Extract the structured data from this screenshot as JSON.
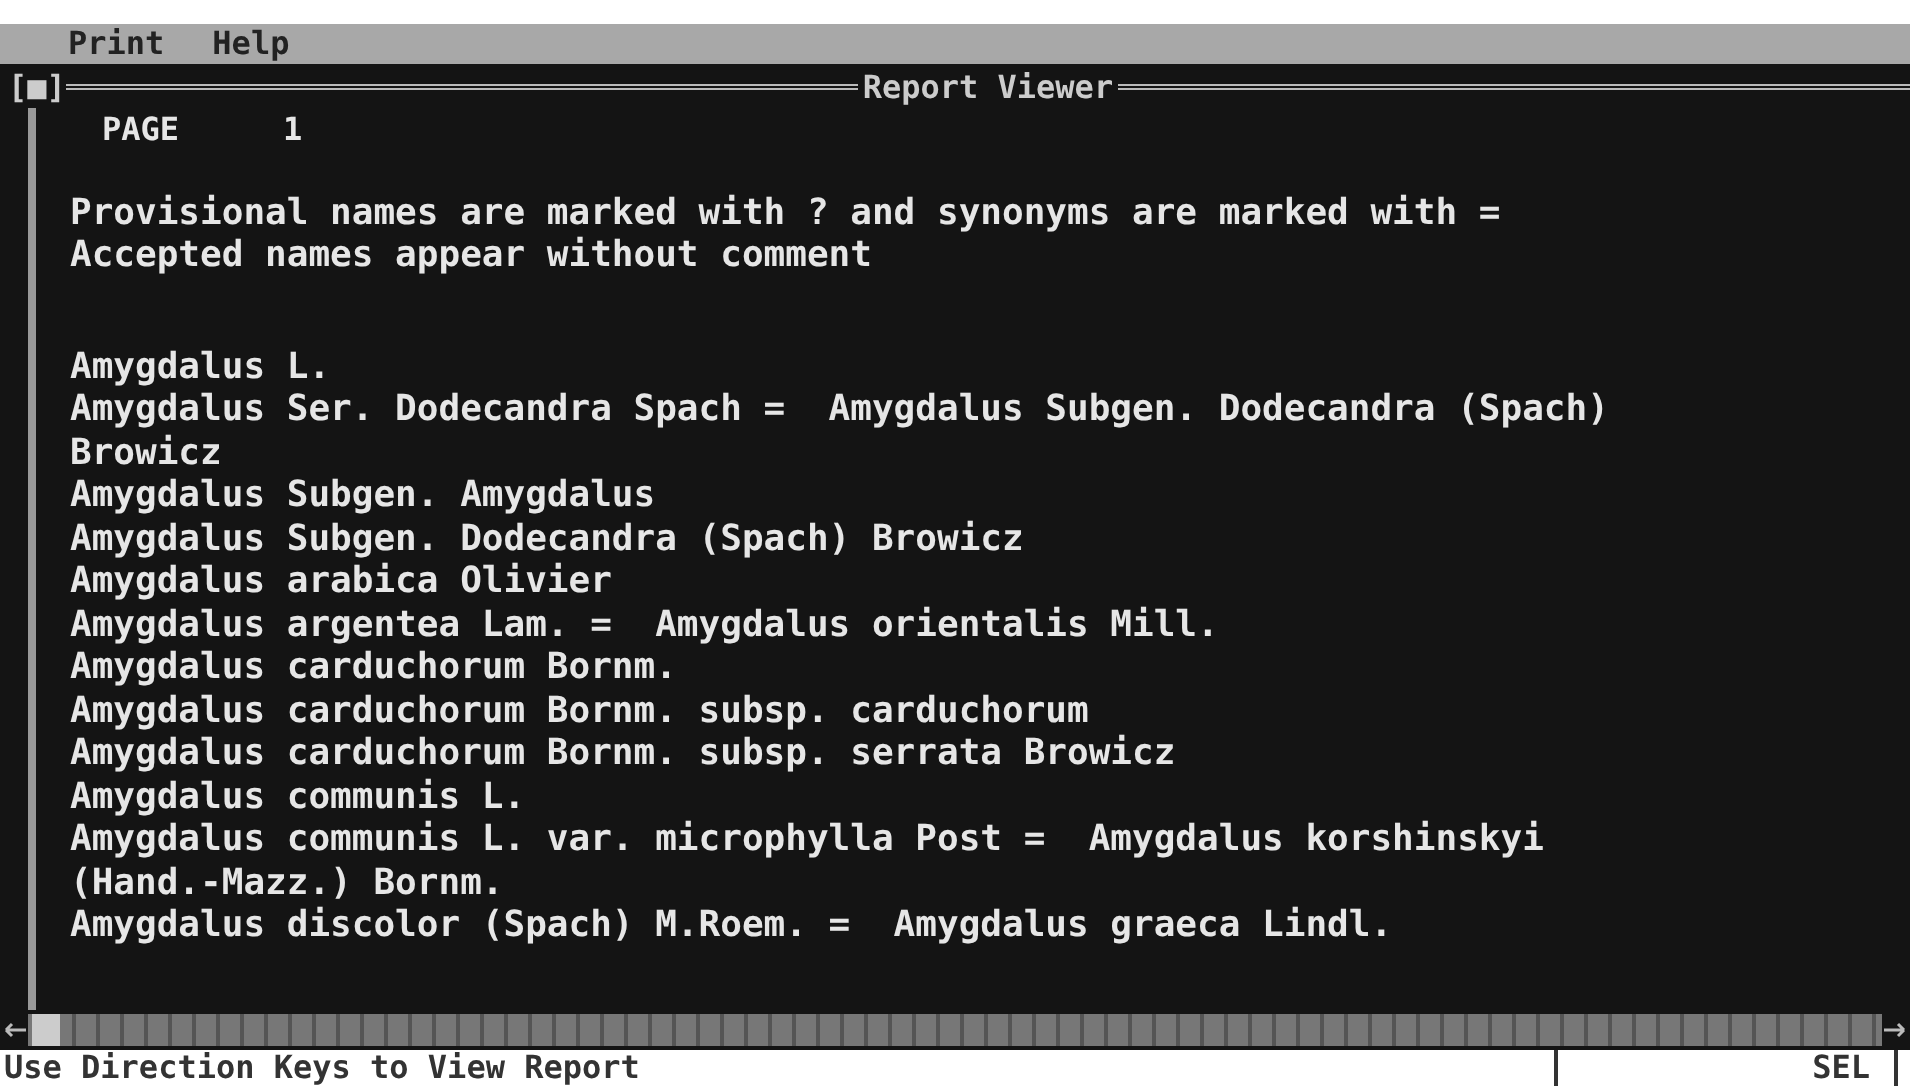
{
  "menu_bar": {
    "items": [
      "Print",
      "Help"
    ]
  },
  "window": {
    "close_box": "[■]",
    "title": "Report Viewer"
  },
  "report": {
    "page_label": "PAGE",
    "page_number": "1",
    "legend": [
      "Provisional names are marked with ? and synonyms are marked with =",
      "Accepted names appear without comment"
    ],
    "lines": [
      "Amygdalus L.",
      "Amygdalus Ser. Dodecandra Spach =  Amygdalus Subgen. Dodecandra (Spach)",
      "Browicz",
      "Amygdalus Subgen. Amygdalus",
      "Amygdalus Subgen. Dodecandra (Spach) Browicz",
      "Amygdalus arabica Olivier",
      "Amygdalus argentea Lam. =  Amygdalus orientalis Mill.",
      "Amygdalus carduchorum Bornm.",
      "Amygdalus carduchorum Bornm. subsp. carduchorum",
      "Amygdalus carduchorum Bornm. subsp. serrata Browicz",
      "Amygdalus communis L.",
      "Amygdalus communis L. var. microphylla Post =  Amygdalus korshinskyi",
      "(Hand.-Mazz.) Bornm.",
      "Amygdalus discolor (Spach) M.Roem. =  Amygdalus graeca Lindl."
    ]
  },
  "status_bar": {
    "message": "Use Direction Keys to View Report",
    "mode": "SEL"
  }
}
